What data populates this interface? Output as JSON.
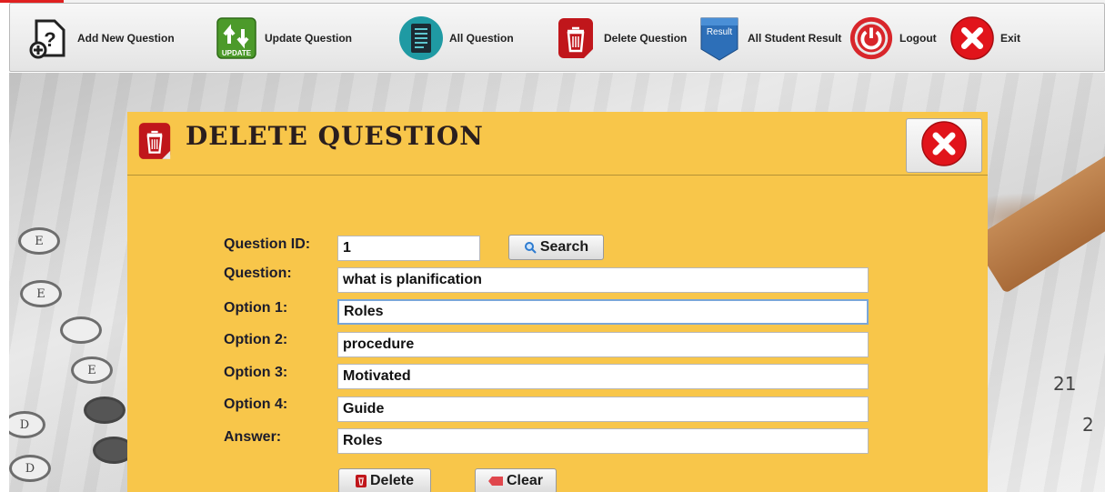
{
  "toolbar": {
    "items": [
      {
        "label": "Add New Question",
        "icon": "add-question-icon"
      },
      {
        "label": "Update Question",
        "icon": "update-icon"
      },
      {
        "label": "All Question",
        "icon": "document-list-icon"
      },
      {
        "label": "Delete Question",
        "icon": "trash-icon"
      },
      {
        "label": "All Student Result",
        "icon": "result-badge-icon",
        "icon_text": "Result"
      },
      {
        "label": "Logout",
        "icon": "power-icon"
      },
      {
        "label": "Exit",
        "icon": "close-icon"
      }
    ]
  },
  "dialog": {
    "title": "DELETE QUESTION",
    "fields": {
      "question_id": {
        "label": "Question ID:",
        "value": "1"
      },
      "question": {
        "label": "Question:",
        "value": "what is planification"
      },
      "option1": {
        "label": "Option 1:",
        "value": "Roles"
      },
      "option2": {
        "label": "Option 2:",
        "value": "procedure"
      },
      "option3": {
        "label": "Option 3:",
        "value": "Motivated"
      },
      "option4": {
        "label": "Option 4:",
        "value": "Guide"
      },
      "answer": {
        "label": "Answer:",
        "value": "Roles"
      }
    },
    "search_label": "Search",
    "delete_label": "Delete",
    "clear_label": "Clear"
  },
  "background": {
    "bubble_letters": [
      "E",
      "E",
      "E",
      "D",
      "D"
    ],
    "sheet_numbers": [
      "21",
      "2"
    ]
  },
  "colors": {
    "panel": "#f8c64a",
    "toolbar": "#ececec",
    "danger": "#d9191f",
    "accent_blue": "#2d7bd0"
  }
}
